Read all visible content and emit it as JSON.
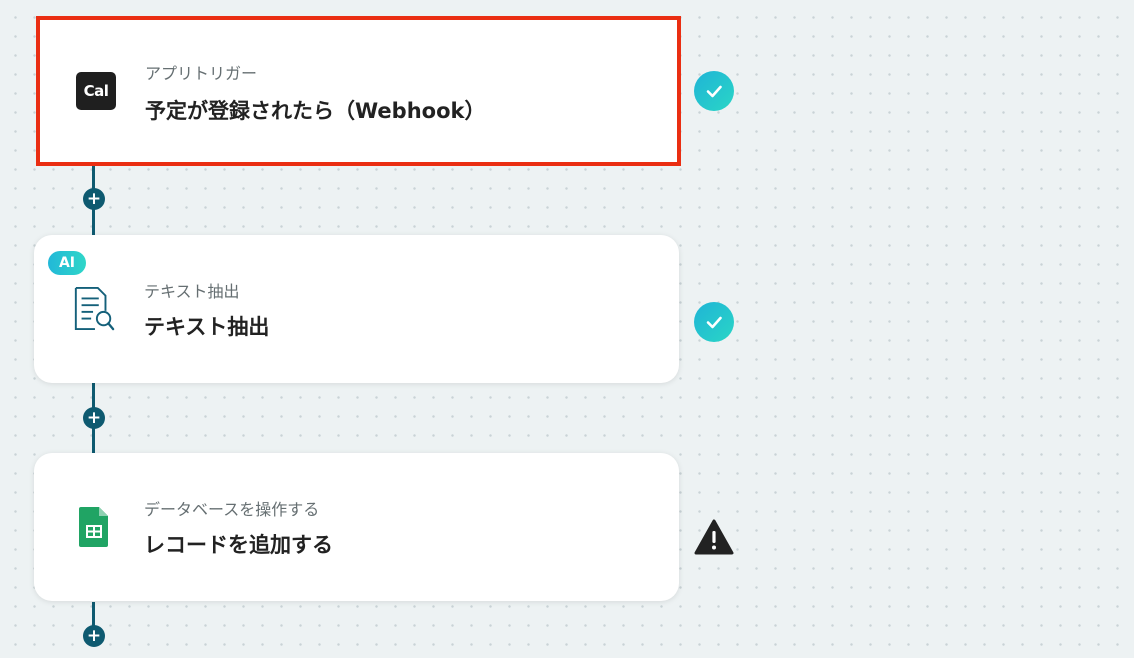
{
  "steps": [
    {
      "subtitle": "アプリトリガー",
      "title": "予定が登録されたら（Webhook）",
      "app_icon": "cal-logo",
      "app_icon_text": "Cal",
      "status": "success",
      "status_icon": "check-icon",
      "selected": true
    },
    {
      "subtitle": "テキスト抽出",
      "title": "テキスト抽出",
      "badge": "AI",
      "app_icon": "document-search-icon",
      "status": "success",
      "status_icon": "check-icon"
    },
    {
      "subtitle": "データベースを操作する",
      "title": "レコードを追加する",
      "app_icon": "google-sheets-icon",
      "status": "warning",
      "status_icon": "warning-icon"
    }
  ],
  "add_button_label": "+",
  "colors": {
    "connector": "#0e5a70",
    "selected_border": "#ea2e12",
    "success": "#22c3d0",
    "warning": "#222222",
    "sheets_green": "#20a464"
  }
}
